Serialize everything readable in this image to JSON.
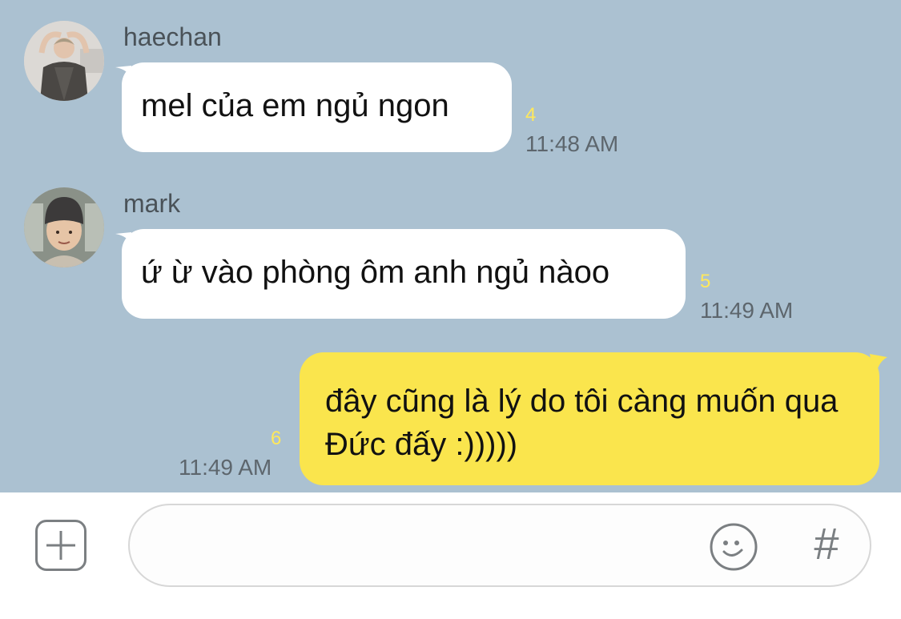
{
  "messages": [
    {
      "sender": "haechan",
      "text": "mel của em ngủ ngon",
      "unread_count": "4",
      "time": "11:48 AM",
      "avatar": "photo-avatar-haechan"
    },
    {
      "sender": "mark",
      "text": "ứ ừ vào phòng ôm anh ngủ nàoo",
      "unread_count": "5",
      "time": "11:49 AM",
      "avatar": "photo-avatar-mark"
    },
    {
      "sender": "",
      "text": "đây cũng là lý do tôi càng muốn qua Đức đấy :)))))",
      "unread_count": "6",
      "time": "11:49 AM",
      "outgoing": true
    }
  ],
  "input_bar": {
    "attach_icon": "plus-box-icon",
    "emoji_icon": "smiley-icon",
    "hash_label": "#",
    "placeholder": ""
  },
  "colors": {
    "chat_background": "#abc1d1",
    "incoming_bubble": "#ffffff",
    "outgoing_bubble": "#fae54d",
    "unread_count": "#ffe85b"
  }
}
